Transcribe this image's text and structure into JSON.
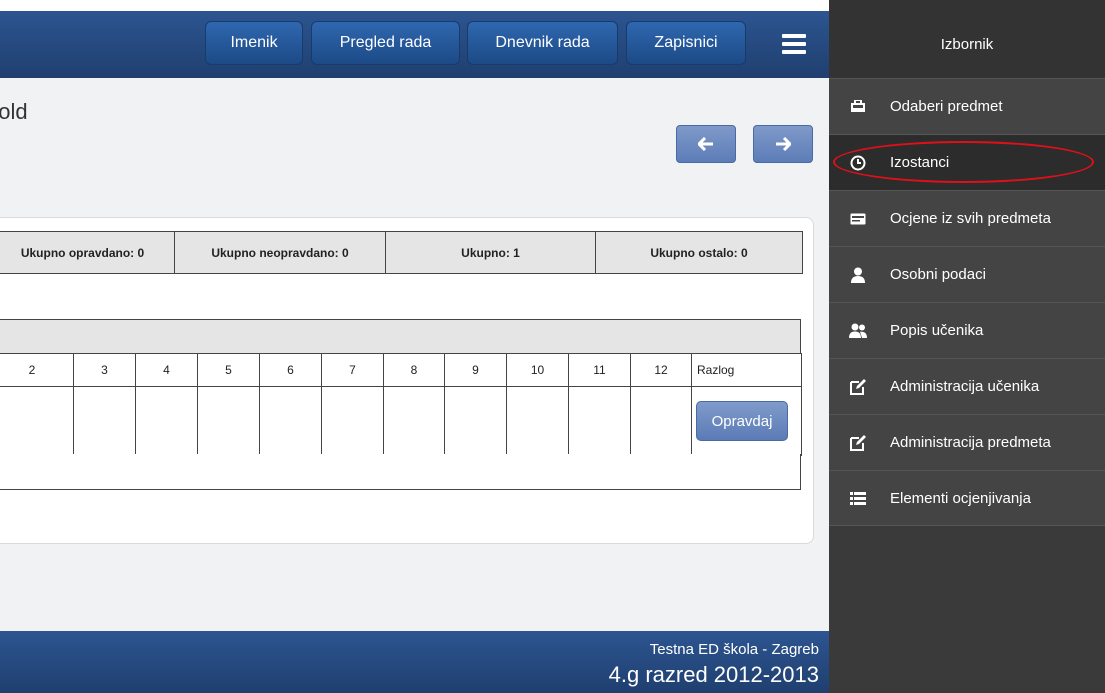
{
  "header": {
    "nav": [
      "Imenik",
      "Pregled rada",
      "Dnevnik rada",
      "Zapisnici"
    ],
    "menu_icon": "hamburger-icon"
  },
  "page": {
    "title": "bold"
  },
  "navigation": {
    "prev_icon": "arrow-left-icon",
    "next_icon": "arrow-right-icon"
  },
  "summary": {
    "cells": [
      "Ukupno opravdano: 0",
      "Ukupno neopravdano: 0",
      "Ukupno: 1",
      "Ukupno ostalo: 0"
    ]
  },
  "grid": {
    "columns": [
      "2",
      "3",
      "4",
      "5",
      "6",
      "7",
      "8",
      "9",
      "10",
      "11",
      "12",
      "Razlog"
    ],
    "button_label": "Opravdaj"
  },
  "footer": {
    "school": "Testna ED škola - Zagreb",
    "class": "4.g razred 2012-2013"
  },
  "sidebar": {
    "title": "Izbornik",
    "items": [
      {
        "label": "Odaberi predmet",
        "icon": "briefcase-icon"
      },
      {
        "label": "Izostanci",
        "icon": "clock-icon",
        "active": true
      },
      {
        "label": "Ocjene iz svih predmeta",
        "icon": "card-icon"
      },
      {
        "label": "Osobni podaci",
        "icon": "user-icon"
      },
      {
        "label": "Popis učenika",
        "icon": "users-icon"
      },
      {
        "label": "Administracija učenika",
        "icon": "edit-icon"
      },
      {
        "label": "Administracija predmeta",
        "icon": "edit-icon"
      },
      {
        "label": "Elementi ocjenjivanja",
        "icon": "list-icon"
      }
    ]
  },
  "colors": {
    "header_blue": "#2d5591",
    "highlight_oval": "#e0101a",
    "sidebar_bg": "#444444"
  }
}
